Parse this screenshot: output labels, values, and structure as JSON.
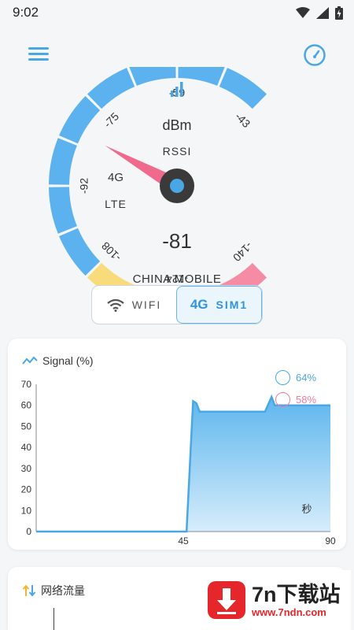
{
  "status_bar": {
    "time": "9:02"
  },
  "gauge": {
    "unit": "dBm",
    "metric": "RSSI",
    "network": "4G",
    "tech": "LTE",
    "value": "-81",
    "signal_dbm": -81,
    "range": [
      -140,
      -43
    ],
    "tick_labels": [
      "-140",
      "-124",
      "-108",
      "-92",
      "-75",
      "-59",
      "-43"
    ],
    "carrier": "CHINA MOBILE"
  },
  "toggle": {
    "wifi_label": "WIFI",
    "sim_badge": "4G",
    "sim_label": "SIM1",
    "active": "sim"
  },
  "signal_card": {
    "title": "Signal (%)",
    "legend": [
      {
        "value": "64%"
      },
      {
        "value": "58%"
      }
    ],
    "unit_label": "秒"
  },
  "chart_data": {
    "type": "area",
    "x": [
      0,
      45,
      46,
      48,
      49,
      50,
      70,
      72,
      73,
      90
    ],
    "series": [
      {
        "values": [
          0,
          0,
          0,
          62,
          61,
          57,
          57,
          64,
          60,
          60
        ]
      }
    ],
    "xlim": [
      0,
      90
    ],
    "ylim": [
      0,
      70
    ],
    "x_ticks": [
      "45",
      "90"
    ],
    "y_ticks": [
      "0",
      "10",
      "20",
      "30",
      "40",
      "50",
      "60",
      "70"
    ],
    "grid": false,
    "color": "#5db6ee"
  },
  "traffic_card": {
    "title": "网络流量"
  },
  "watermark": {
    "title": "7n下载站",
    "url": "www.7ndn.com"
  },
  "colors": {
    "blue": "#5bb2ef",
    "yellow": "#f8dc7c",
    "pink": "#f68ba6",
    "needle": "#f06a8e",
    "accent": "#2f93dd"
  }
}
